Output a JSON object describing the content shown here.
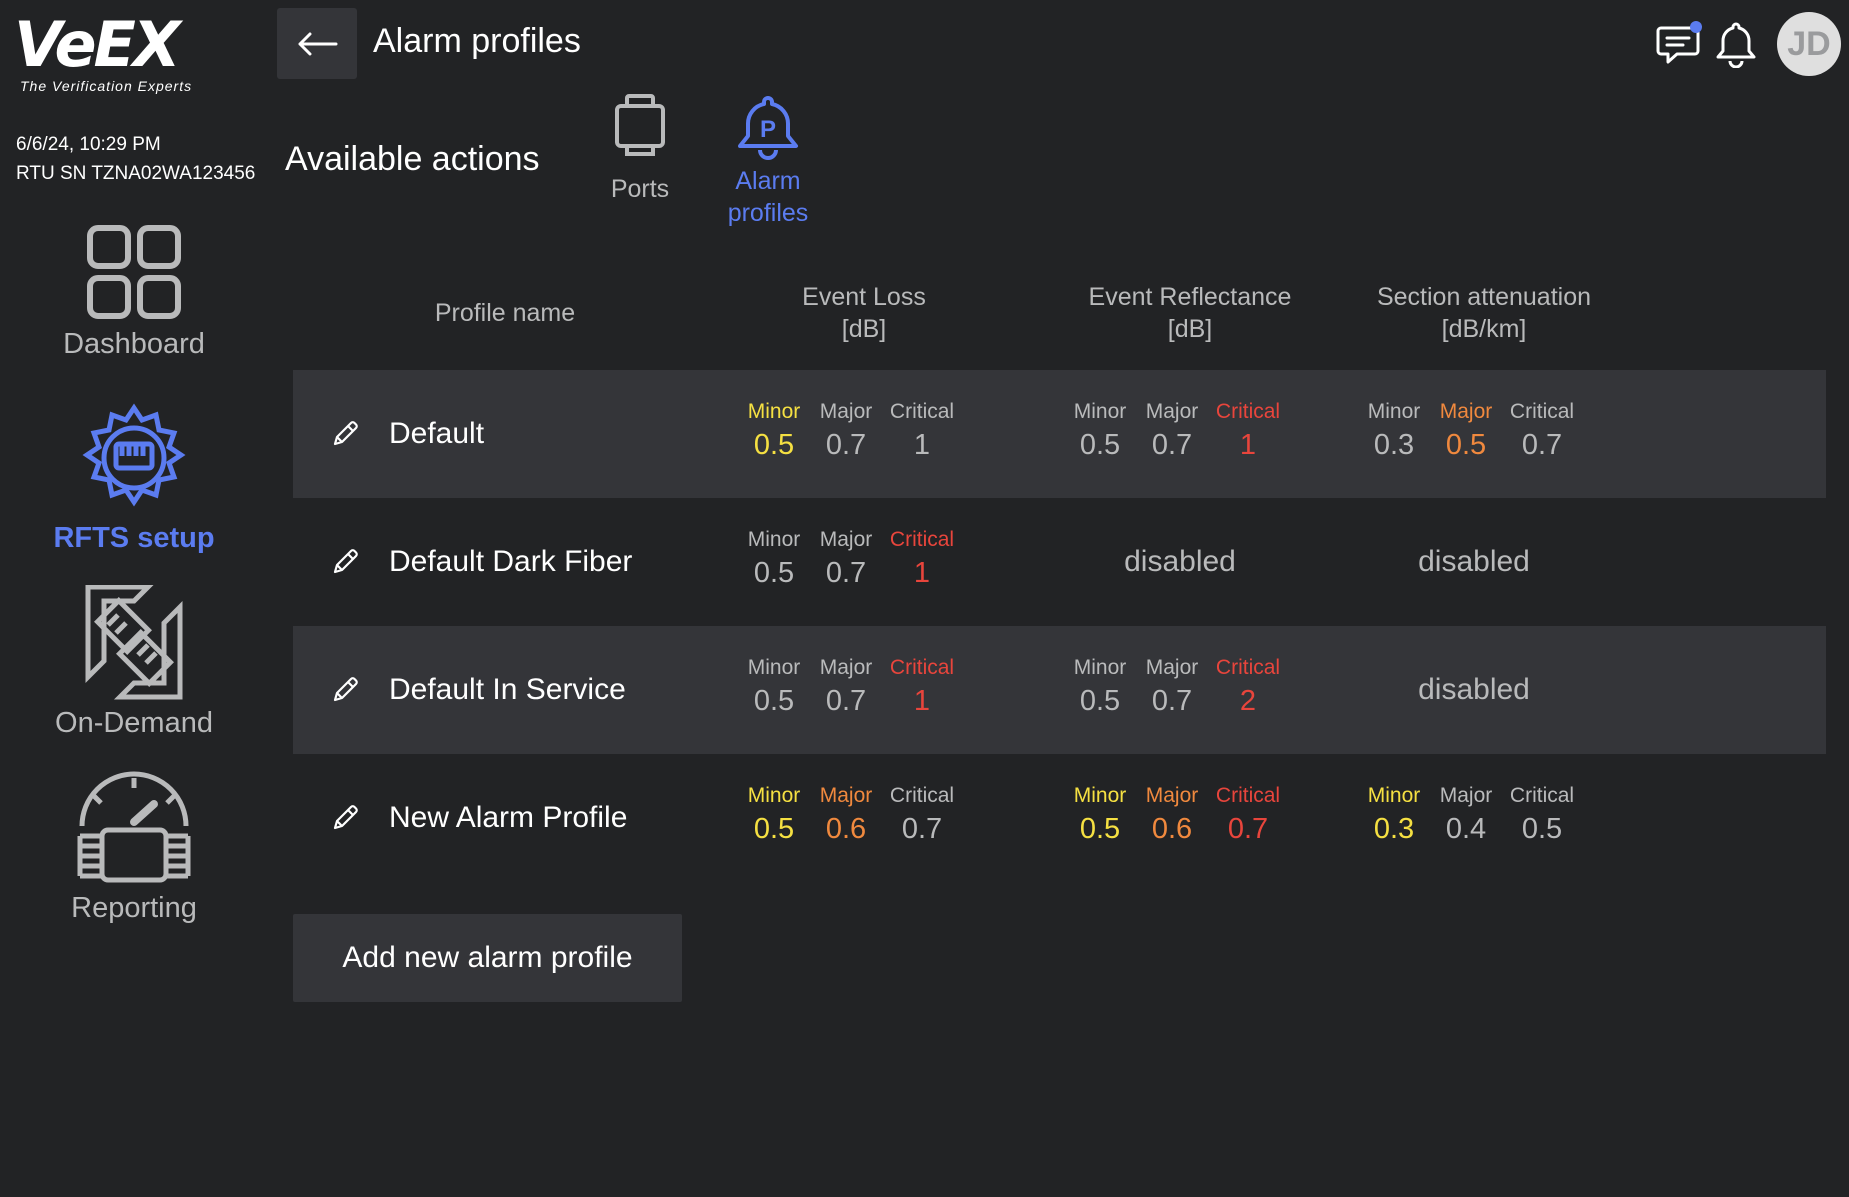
{
  "brand": {
    "logo_text": "VeEX",
    "tagline": "The Verification Experts"
  },
  "device": {
    "datetime": "6/6/24, 10:29 PM",
    "serial": "RTU SN TZNA02WA123456"
  },
  "nav": [
    {
      "label": "Dashboard",
      "icon": "dashboard-icon",
      "active": false
    },
    {
      "label": "RFTS setup",
      "icon": "gear-port-icon",
      "active": true
    },
    {
      "label": "On-Demand",
      "icon": "fiber-connector-icon",
      "active": false
    },
    {
      "label": "Reporting",
      "icon": "gauge-icon",
      "active": false
    }
  ],
  "header": {
    "title": "Alarm profiles",
    "avatar_initials": "JD",
    "accent_color": "#5b7cf0"
  },
  "actions": {
    "title": "Available actions",
    "items": [
      {
        "label": "Ports",
        "icon": "port-icon",
        "active": false
      },
      {
        "label_line1": "Alarm",
        "label_line2": "profiles",
        "icon": "alarm-profile-icon",
        "active": true
      }
    ]
  },
  "table": {
    "headers": {
      "profile_name": "Profile name",
      "event_loss": {
        "line1": "Event Loss",
        "line2": "[dB]"
      },
      "event_reflectance": {
        "line1": "Event Reflectance",
        "line2": "[dB]"
      },
      "section_attenuation": {
        "line1": "Section attenuation",
        "line2": "[dB/km]"
      }
    },
    "level_labels": {
      "minor": "Minor",
      "major": "Major",
      "critical": "Critical"
    },
    "disabled_text": "disabled",
    "rows": [
      {
        "name": "Default",
        "event_loss": {
          "minor": "0.5",
          "major": "0.7",
          "critical": "1",
          "active": "minor"
        },
        "event_reflectance": {
          "minor": "0.5",
          "major": "0.7",
          "critical": "1",
          "active": "critical"
        },
        "section_attenuation": {
          "minor": "0.3",
          "major": "0.5",
          "critical": "0.7",
          "active": "major"
        }
      },
      {
        "name": "Default Dark Fiber",
        "event_loss": {
          "minor": "0.5",
          "major": "0.7",
          "critical": "1",
          "active": "critical"
        },
        "event_reflectance": "disabled",
        "section_attenuation": "disabled"
      },
      {
        "name": "Default In Service",
        "event_loss": {
          "minor": "0.5",
          "major": "0.7",
          "critical": "1",
          "active": "critical"
        },
        "event_reflectance": {
          "minor": "0.5",
          "major": "0.7",
          "critical": "2",
          "active": "critical"
        },
        "section_attenuation": "disabled"
      },
      {
        "name": "New Alarm Profile",
        "event_loss": {
          "minor": "0.5",
          "major": "0.6",
          "critical": "0.7",
          "active": "major"
        },
        "event_reflectance": {
          "minor": "0.5",
          "major": "0.6",
          "critical": "0.7",
          "active": "critical"
        },
        "section_attenuation": {
          "minor": "0.3",
          "major": "0.4",
          "critical": "0.5",
          "active": "minor"
        }
      }
    ]
  },
  "add_button_label": "Add new alarm profile",
  "colors": {
    "minor": "#f5e042",
    "major": "#f0893e",
    "critical": "#e8453c",
    "muted": "#b9babb"
  }
}
